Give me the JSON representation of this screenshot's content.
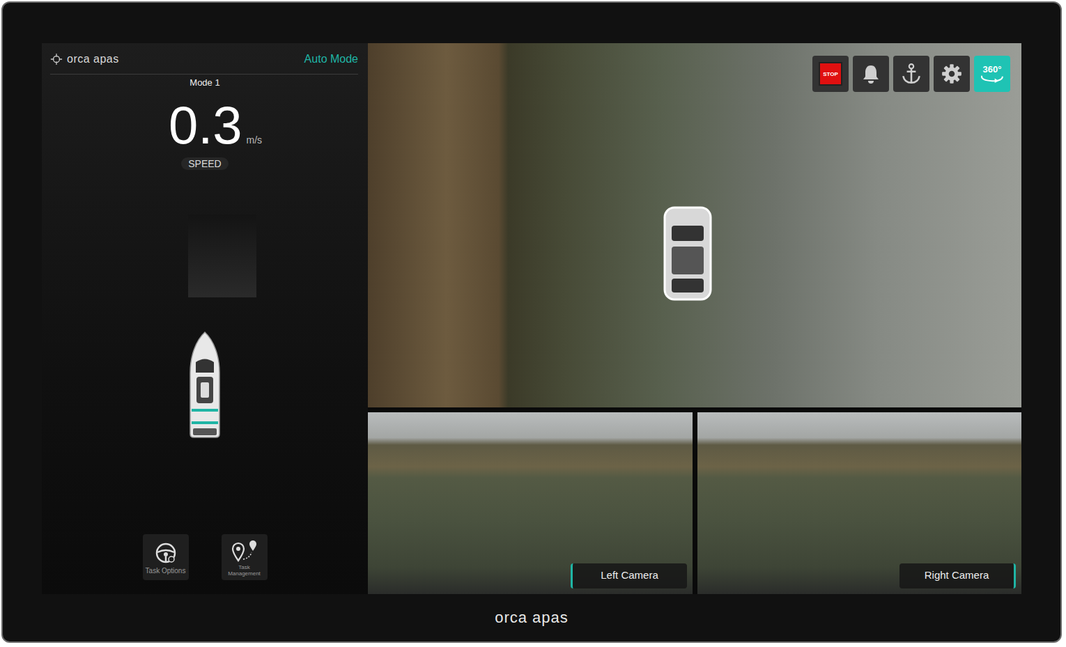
{
  "header": {
    "logo": "orca apas",
    "mode_status": "Auto Mode"
  },
  "speed": {
    "mode": "Mode 1",
    "value": "0.3",
    "unit": "m/s",
    "label": "SPEED"
  },
  "toolbar": [
    {
      "kind": "stop",
      "label": "STOP",
      "selected": false
    },
    {
      "kind": "bell",
      "selected": false
    },
    {
      "kind": "anchor",
      "selected": false
    },
    {
      "kind": "settings",
      "selected": false
    },
    {
      "kind": "view360",
      "label": "360°",
      "selected": true
    }
  ],
  "task_buttons": [
    {
      "kind": "steering",
      "label": "Task Options"
    },
    {
      "kind": "route",
      "label": "Task Management"
    }
  ],
  "cameras": [
    {
      "label": "Left Camera"
    },
    {
      "label": "Right Camera"
    }
  ],
  "footer": {
    "brand": "orca apas"
  }
}
